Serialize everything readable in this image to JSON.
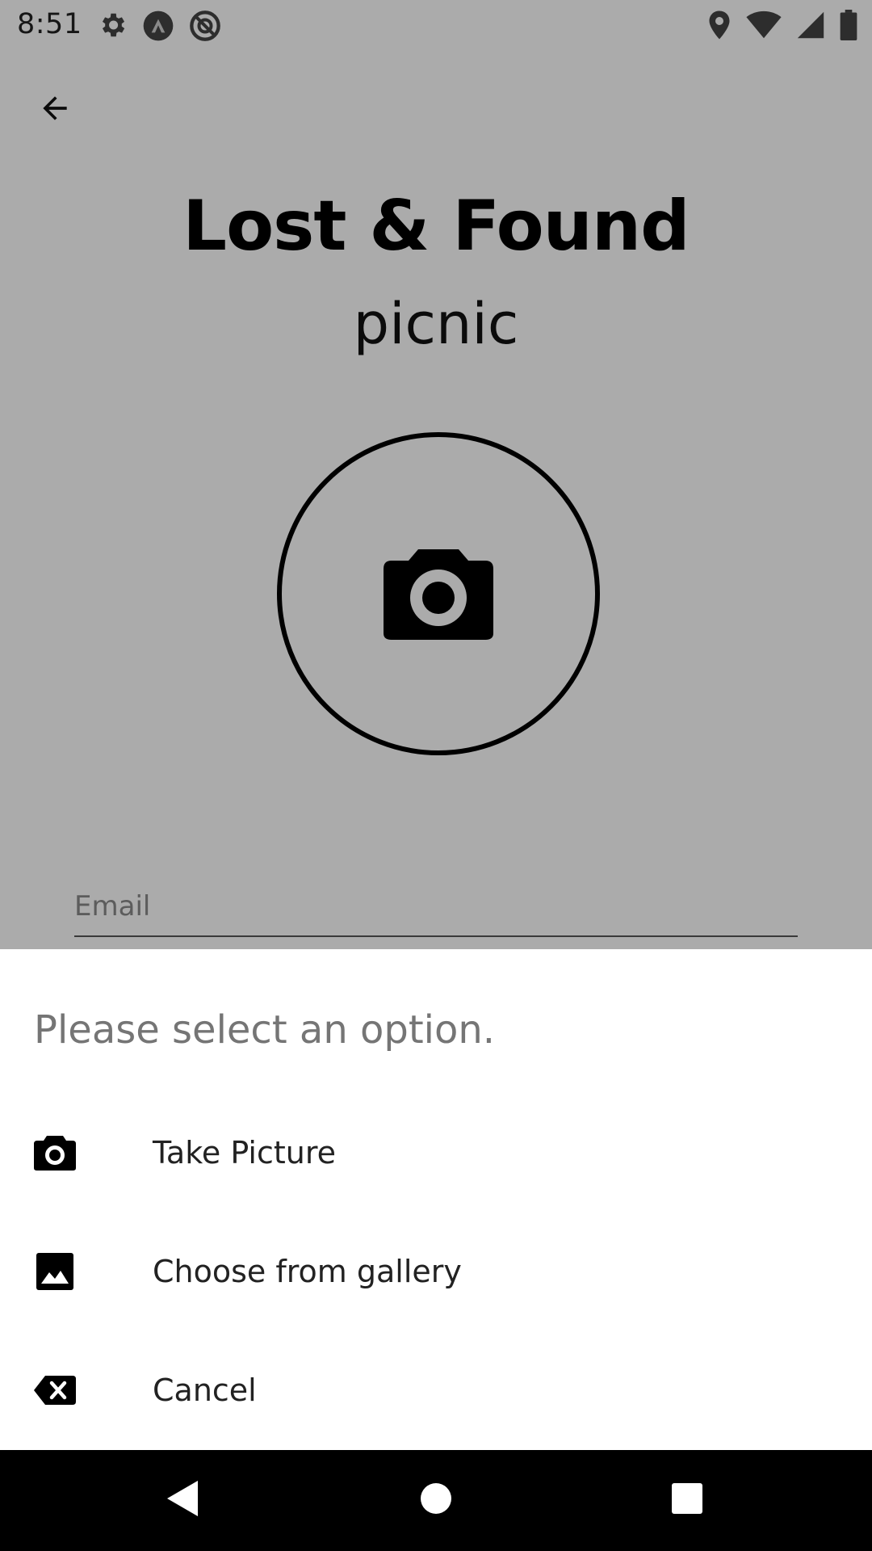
{
  "status_bar": {
    "time": "8:51",
    "left_icons": [
      "settings-icon",
      "arrow-up-circle-icon",
      "no-sim-circle-icon"
    ],
    "right_icons": [
      "location-icon",
      "wifi-icon",
      "cell-signal-icon",
      "battery-icon"
    ]
  },
  "header": {
    "back_icon": "arrow-back-icon"
  },
  "main": {
    "title": "Lost & Found",
    "subtitle": "picnic",
    "photo_icon": "camera-icon",
    "email_placeholder": "Email"
  },
  "sheet": {
    "title": "Please select an option.",
    "options": [
      {
        "icon": "camera-icon",
        "label": "Take Picture"
      },
      {
        "icon": "image-icon",
        "label": "Choose from gallery"
      },
      {
        "icon": "backspace-x-icon",
        "label": "Cancel"
      }
    ]
  },
  "nav_bar": {
    "buttons": [
      "back-triangle-icon",
      "home-circle-icon",
      "recents-square-icon"
    ]
  },
  "colors": {
    "scrim": "#000000",
    "sheet_bg": "#ffffff",
    "sheet_title": "#757575",
    "nav_bg": "#000000"
  }
}
